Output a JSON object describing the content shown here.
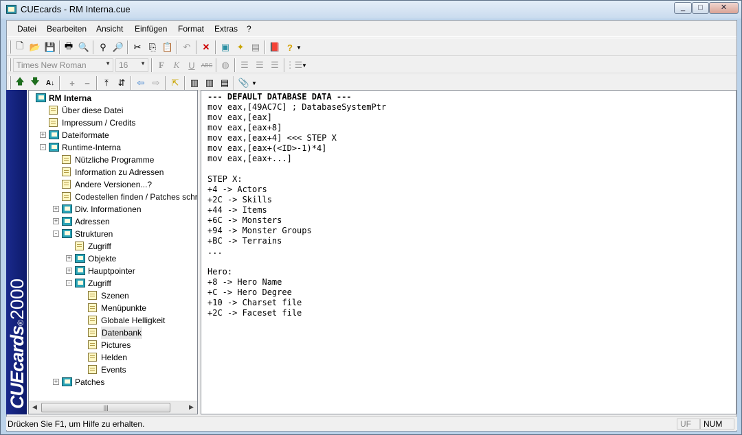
{
  "window": {
    "title": "CUEcards - RM Interna.cue",
    "minimize": "_",
    "maximize": "□",
    "close": "✕"
  },
  "menu": [
    "Datei",
    "Bearbeiten",
    "Ansicht",
    "Einfügen",
    "Format",
    "Extras",
    "?"
  ],
  "format_toolbar": {
    "font": "Times New Roman",
    "size": "16"
  },
  "sidebar": {
    "brand_main": "CUEcards",
    "brand_reg": "®",
    "brand_year": "2000"
  },
  "tree": {
    "nodes": [
      {
        "label": "RM Interna",
        "level": 0,
        "icon": "book",
        "expander": "",
        "bold": true
      },
      {
        "label": "Über diese Datei",
        "level": 1,
        "icon": "page",
        "expander": ""
      },
      {
        "label": "Impressum / Credits",
        "level": 1,
        "icon": "page",
        "expander": ""
      },
      {
        "label": "Dateiformate",
        "level": 1,
        "icon": "book",
        "expander": "+"
      },
      {
        "label": "Runtime-Interna",
        "level": 1,
        "icon": "book",
        "expander": "-"
      },
      {
        "label": "Nützliche Programme",
        "level": 2,
        "icon": "page",
        "expander": ""
      },
      {
        "label": "Information zu Adressen",
        "level": 2,
        "icon": "page",
        "expander": ""
      },
      {
        "label": "Andere Versionen...?",
        "level": 2,
        "icon": "page",
        "expander": ""
      },
      {
        "label": "Codestellen finden / Patches schre",
        "level": 2,
        "icon": "page",
        "expander": ""
      },
      {
        "label": "Div. Informationen",
        "level": 2,
        "icon": "book",
        "expander": "+"
      },
      {
        "label": "Adressen",
        "level": 2,
        "icon": "book",
        "expander": "+"
      },
      {
        "label": "Strukturen",
        "level": 2,
        "icon": "book",
        "expander": "-"
      },
      {
        "label": "Zugriff",
        "level": 3,
        "icon": "page",
        "expander": ""
      },
      {
        "label": "Objekte",
        "level": 3,
        "icon": "book",
        "expander": "+"
      },
      {
        "label": "Hauptpointer",
        "level": 3,
        "icon": "book",
        "expander": "+"
      },
      {
        "label": "Zugriff",
        "level": 3,
        "icon": "book",
        "expander": "-"
      },
      {
        "label": "Szenen",
        "level": 4,
        "icon": "page",
        "expander": ""
      },
      {
        "label": "Menüpunkte",
        "level": 4,
        "icon": "page",
        "expander": ""
      },
      {
        "label": "Globale Helligkeit",
        "level": 4,
        "icon": "page",
        "expander": ""
      },
      {
        "label": "Datenbank",
        "level": 4,
        "icon": "page",
        "expander": "",
        "selected": true
      },
      {
        "label": "Pictures",
        "level": 4,
        "icon": "page",
        "expander": ""
      },
      {
        "label": "Helden",
        "level": 4,
        "icon": "page",
        "expander": ""
      },
      {
        "label": "Events",
        "level": 4,
        "icon": "page",
        "expander": ""
      },
      {
        "label": "Patches",
        "level": 2,
        "icon": "book",
        "expander": "+"
      }
    ],
    "scroll_grip": "|||"
  },
  "editor": {
    "lines": [
      "--- DEFAULT DATABASE DATA ---",
      "mov eax,[49AC7C] ; DatabaseSystemPtr",
      "mov eax,[eax]",
      "mov eax,[eax+8]",
      "mov eax,[eax+4] <<< STEP X",
      "mov eax,[eax+(<ID>-1)*4]",
      "mov eax,[eax+...]",
      "",
      "STEP X:",
      "+4 -> Actors",
      "+2C -> Skills",
      "+44 -> Items",
      "+6C -> Monsters",
      "+94 -> Monster Groups",
      "+BC -> Terrains",
      "...",
      "",
      "Hero:",
      "+8 -> Hero Name",
      "+C -> Hero Degree",
      "+10 -> Charset file",
      "+2C -> Faceset file"
    ]
  },
  "status": {
    "text": "Drücken Sie F1, um Hilfe zu erhalten.",
    "uf": "UF",
    "num": "NUM"
  },
  "colors": {
    "sidebar": "#1a2a8c",
    "selection": "#e8e8e8"
  }
}
